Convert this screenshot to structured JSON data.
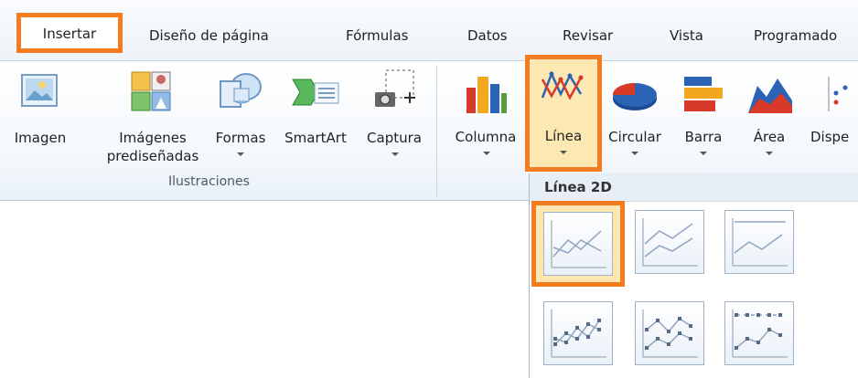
{
  "tabs": [
    {
      "label": "Insertar",
      "active": true
    },
    {
      "label": "Diseño de página"
    },
    {
      "label": "Fórmulas"
    },
    {
      "label": "Datos"
    },
    {
      "label": "Revisar"
    },
    {
      "label": "Vista"
    },
    {
      "label": "Programado"
    }
  ],
  "ribbon": {
    "illustrations": {
      "group_label": "Ilustraciones",
      "buttons": [
        {
          "label": "Imagen",
          "icon": "image-icon"
        },
        {
          "label": "Imágenes",
          "label2": "prediseñadas",
          "icon": "clipart-icon"
        },
        {
          "label": "Formas",
          "icon": "shapes-icon"
        },
        {
          "label": "SmartArt",
          "icon": "smartart-icon"
        },
        {
          "label": "Captura",
          "icon": "screenshot-icon"
        }
      ]
    },
    "charts": {
      "buttons": [
        {
          "label": "Columna",
          "icon": "column-chart-icon"
        },
        {
          "label": "Línea",
          "icon": "line-chart-icon",
          "highlighted": true
        },
        {
          "label": "Circular",
          "icon": "pie-chart-icon"
        },
        {
          "label": "Barra",
          "icon": "bar-chart-icon"
        },
        {
          "label": "Área",
          "icon": "area-chart-icon"
        },
        {
          "label": "Dispe",
          "icon": "scatter-chart-icon"
        }
      ]
    }
  },
  "dropdown": {
    "header": "Línea 2D",
    "thumbnails": [
      "line-icon",
      "stacked-line-icon",
      "100-stacked-line-icon",
      "line-markers-icon",
      "stacked-line-markers-icon",
      "100-stacked-line-markers-icon"
    ]
  },
  "colors": {
    "highlight": "#f47b20",
    "ribbon_bg": "#f4f8fc"
  }
}
